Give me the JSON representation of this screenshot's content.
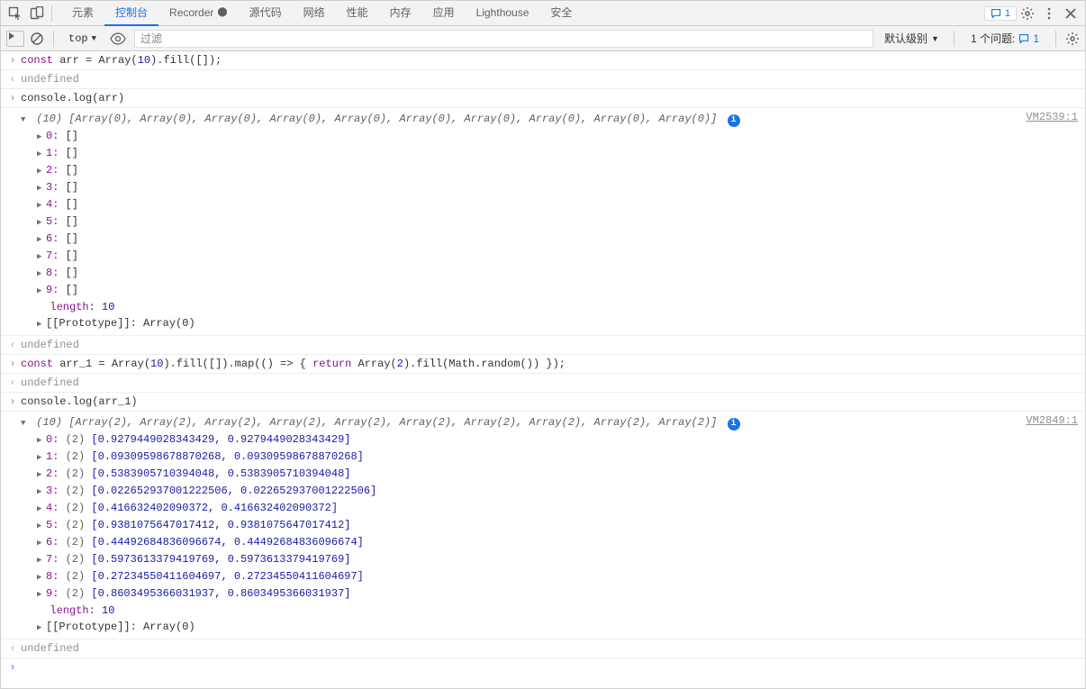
{
  "maintabs": {
    "elements": "元素",
    "console": "控制台",
    "recorder": "Recorder",
    "sources": "源代码",
    "network": "网络",
    "performance": "性能",
    "memory": "内存",
    "application": "应用",
    "lighthouse": "Lighthouse",
    "security": "安全",
    "badge1": "1"
  },
  "toolbar": {
    "context": "top",
    "filter_placeholder": "过滤",
    "default_level": "默认级别",
    "issues_label": "1 个问题:",
    "issues_count": "1"
  },
  "rows": {
    "r1_code": "const arr = Array(10).fill([]);",
    "r1_out": "undefined",
    "r2_code": "console.log(arr)",
    "r2_summary": "(10) [Array(0), Array(0), Array(0), Array(0), Array(0), Array(0), Array(0), Array(0), Array(0), Array(0)]",
    "r2_src": "VM2539:1",
    "r2_len_label": "length",
    "r2_len_val": "10",
    "r2_proto_label": "[[Prototype]]",
    "r2_proto_val": "Array(0)",
    "r2_item_val": "[]",
    "r2_out": "undefined",
    "r3_code": "const arr_1 = Array(10).fill([]).map(() => { return Array(2).fill(Math.random()) });",
    "r3_out": "undefined",
    "r4_code": "console.log(arr_1)",
    "r4_summary": "(10) [Array(2), Array(2), Array(2), Array(2), Array(2), Array(2), Array(2), Array(2), Array(2), Array(2)]",
    "r4_src": "VM2849:1",
    "r4_count": "(2)",
    "r4_items": [
      "[0.9279449028343429, 0.9279449028343429]",
      "[0.09309598678870268, 0.09309598678870268]",
      "[0.5383905710394048, 0.5383905710394048]",
      "[0.022652937001222506, 0.022652937001222506]",
      "[0.416632402090372, 0.416632402090372]",
      "[0.9381075647017412, 0.9381075647017412]",
      "[0.44492684836096674, 0.44492684836096674]",
      "[0.5973613379419769, 0.5973613379419769]",
      "[0.27234550411604697, 0.27234550411604697]",
      "[0.8603495366031937, 0.8603495366031937]"
    ],
    "r4_len_label": "length",
    "r4_len_val": "10",
    "r4_proto_label": "[[Prototype]]",
    "r4_proto_val": "Array(0)",
    "r4_out": "undefined"
  }
}
